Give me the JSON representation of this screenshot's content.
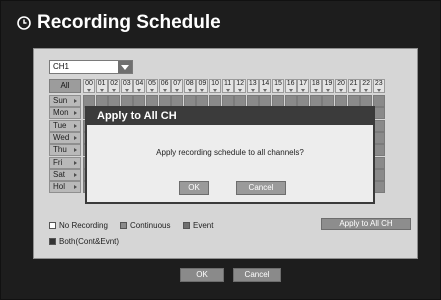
{
  "window": {
    "title": "Recording Schedule"
  },
  "channel": {
    "value": "CH1"
  },
  "grid": {
    "all_label": "All",
    "hours": [
      "00",
      "01",
      "02",
      "03",
      "04",
      "05",
      "06",
      "07",
      "08",
      "09",
      "10",
      "11",
      "12",
      "13",
      "14",
      "15",
      "16",
      "17",
      "18",
      "19",
      "20",
      "21",
      "22",
      "23"
    ],
    "days": [
      "Sun",
      "Mon",
      "Tue",
      "Wed",
      "Thu",
      "Fri",
      "Sat",
      "Hol"
    ]
  },
  "legend": {
    "no_recording": "No Recording",
    "continuous": "Continuous",
    "event": "Event",
    "both": "Both(Cont&Evnt)"
  },
  "buttons": {
    "apply_all": "Apply to All CH",
    "ok": "OK",
    "cancel": "Cancel"
  },
  "dialog": {
    "title": "Apply to All CH",
    "message": "Apply recording schedule to all channels?",
    "ok": "OK",
    "cancel": "Cancel"
  },
  "colors": {
    "continuous": "#8b8b8b",
    "event": "#6f6f6f",
    "both": "#333333",
    "header": "#3b3b3b"
  }
}
